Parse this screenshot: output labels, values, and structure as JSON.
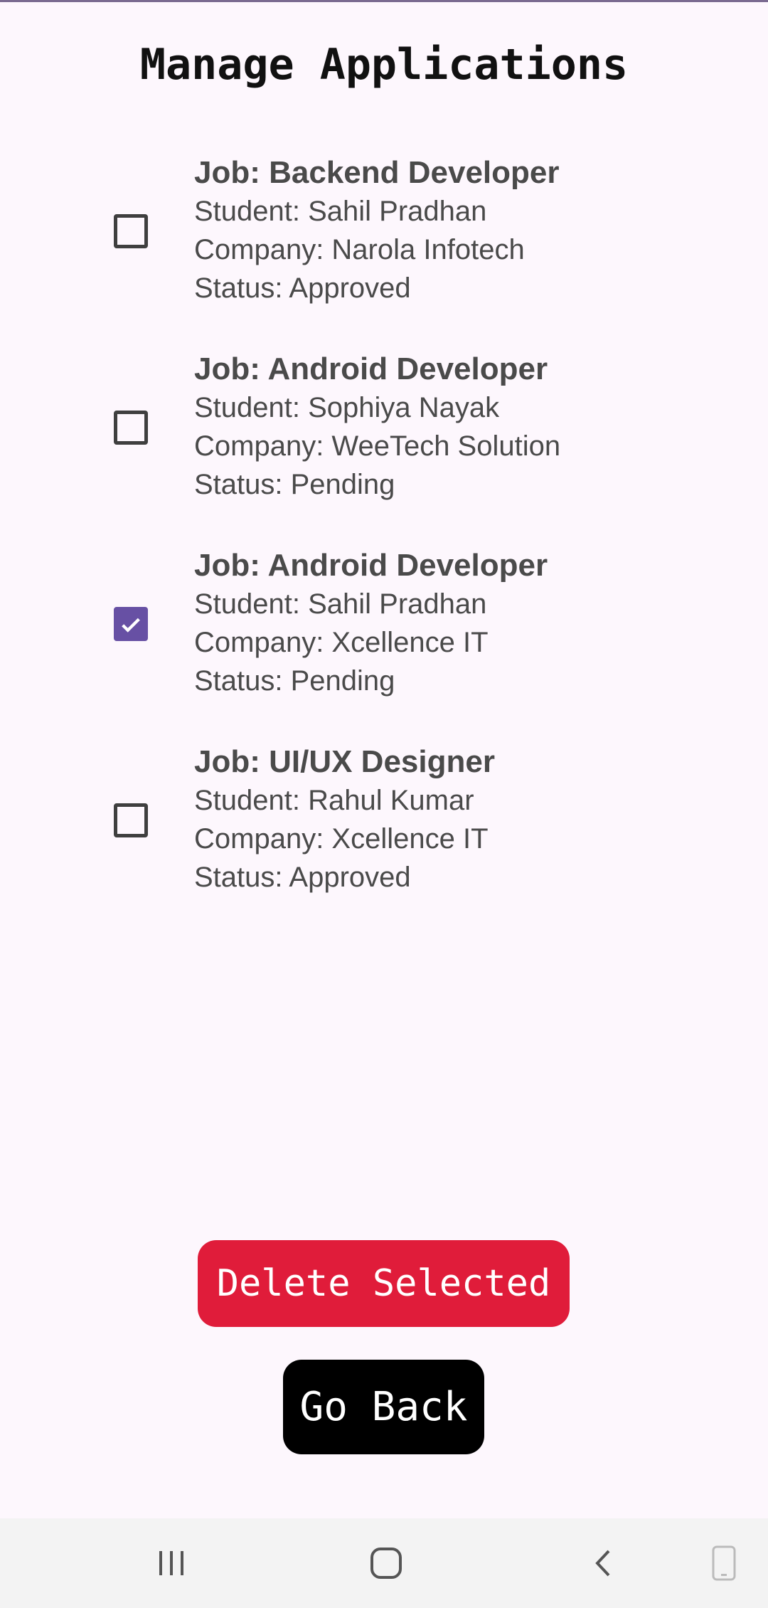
{
  "page": {
    "title": "Manage Applications"
  },
  "applications": [
    {
      "job": "Job: Backend Developer",
      "student": "Student: Sahil Pradhan",
      "company": "Company: Narola Infotech",
      "status": "Status: Approved",
      "checked": false
    },
    {
      "job": "Job: Android Developer",
      "student": "Student: Sophiya Nayak",
      "company": "Company: WeeTech Solution",
      "status": "Status: Pending",
      "checked": false
    },
    {
      "job": "Job: Android Developer",
      "student": "Student: Sahil Pradhan",
      "company": "Company: Xcellence IT",
      "status": "Status: Pending",
      "checked": true
    },
    {
      "job": "Job: UI/UX Designer",
      "student": "Student: Rahul Kumar",
      "company": "Company: Xcellence IT",
      "status": "Status: Approved",
      "checked": false
    }
  ],
  "actions": {
    "delete_label": "Delete Selected",
    "back_label": "Go Back"
  },
  "navbar": {
    "icons": [
      "recent-apps-icon",
      "home-icon",
      "back-icon",
      "rotate-icon"
    ]
  },
  "colors": {
    "accent": "#6750a4",
    "danger": "#e01c3a",
    "background": "#fdf7fd"
  }
}
